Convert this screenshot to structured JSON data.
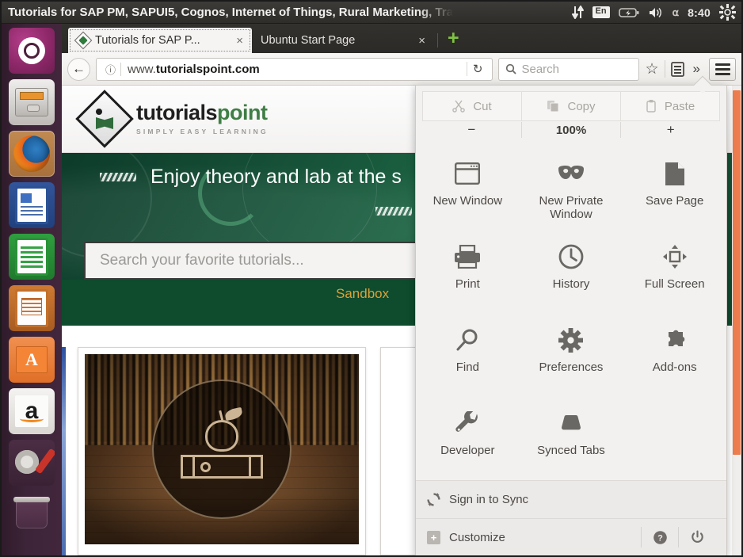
{
  "desktop": {
    "panel_title": "Tutorials for SAP PM, SAPUI5, Cognos, Internet of Things, Rural Marketing, Tra",
    "keyboard_layout": "En",
    "clock": "8:40",
    "icons": {
      "sync": "sync-arrows-icon",
      "keyboard": "keyboard-layout-icon",
      "battery": "battery-icon",
      "volume": "volume-icon",
      "bluetooth": "bluetooth-icon",
      "session": "gear-icon"
    }
  },
  "launcher": {
    "items": [
      {
        "name": "ubuntu-dash",
        "label": "Ubuntu Dash"
      },
      {
        "name": "files",
        "label": "Files"
      },
      {
        "name": "firefox",
        "label": "Firefox Web Browser"
      },
      {
        "name": "libreoffice-writer",
        "label": "LibreOffice Writer"
      },
      {
        "name": "libreoffice-calc",
        "label": "LibreOffice Calc"
      },
      {
        "name": "libreoffice-impress",
        "label": "LibreOffice Impress"
      },
      {
        "name": "ubuntu-software",
        "label": "Ubuntu Software"
      },
      {
        "name": "amazon",
        "label": "Amazon"
      },
      {
        "name": "system-settings",
        "label": "System Settings"
      },
      {
        "name": "trash",
        "label": "Trash"
      }
    ]
  },
  "browser": {
    "tabs": [
      {
        "label": "Tutorials for SAP P...",
        "active": true,
        "close": "×"
      },
      {
        "label": "Ubuntu Start Page",
        "active": false,
        "close": "×"
      }
    ],
    "new_tab_glyph": "+",
    "nav": {
      "back_glyph": "←",
      "identity_glyph": "ⓘ",
      "url_prefix": "www.",
      "url_domain": "tutorialspoint.com",
      "reload_glyph": "↻",
      "search_placeholder": "Search",
      "bookmark_glyph": "☆",
      "library_glyph": "▤",
      "overflow_glyph": "»"
    }
  },
  "page": {
    "logo_word_a": "tutorials",
    "logo_word_b": "point",
    "logo_tagline": "SIMPLY EASY LEARNING",
    "hero_title": "Enjoy theory and lab at the s",
    "hero_search_placeholder": "Search your favorite tutorials...",
    "strip_text": "Sandbox",
    "scrollbar_color": "#ed7d4e"
  },
  "menu": {
    "clipboard": [
      {
        "label": "Cut",
        "icon": "scissors-icon",
        "enabled": false
      },
      {
        "label": "Copy",
        "icon": "copy-icon",
        "enabled": false
      },
      {
        "label": "Paste",
        "icon": "clipboard-icon",
        "enabled": false
      }
    ],
    "zoom": {
      "minus": "−",
      "level": "100%",
      "plus": "+"
    },
    "items": [
      {
        "label": "New Window",
        "icon": "window-icon"
      },
      {
        "label": "New Private Window",
        "icon": "mask-icon"
      },
      {
        "label": "Save Page",
        "icon": "page-icon"
      },
      {
        "label": "Print",
        "icon": "printer-icon"
      },
      {
        "label": "History",
        "icon": "clock-icon"
      },
      {
        "label": "Full Screen",
        "icon": "fullscreen-icon"
      },
      {
        "label": "Find",
        "icon": "magnifier-icon"
      },
      {
        "label": "Preferences",
        "icon": "gear-icon"
      },
      {
        "label": "Add-ons",
        "icon": "puzzle-icon"
      },
      {
        "label": "Developer",
        "icon": "wrench-icon"
      },
      {
        "label": "Synced Tabs",
        "icon": "synced-tabs-icon"
      }
    ],
    "sign_in": {
      "label": "Sign in to Sync",
      "icon": "sync-icon"
    },
    "customize": {
      "label": "Customize",
      "icon": "plus-box-icon"
    },
    "help_glyph": "?",
    "quit_glyph": "⏻"
  }
}
